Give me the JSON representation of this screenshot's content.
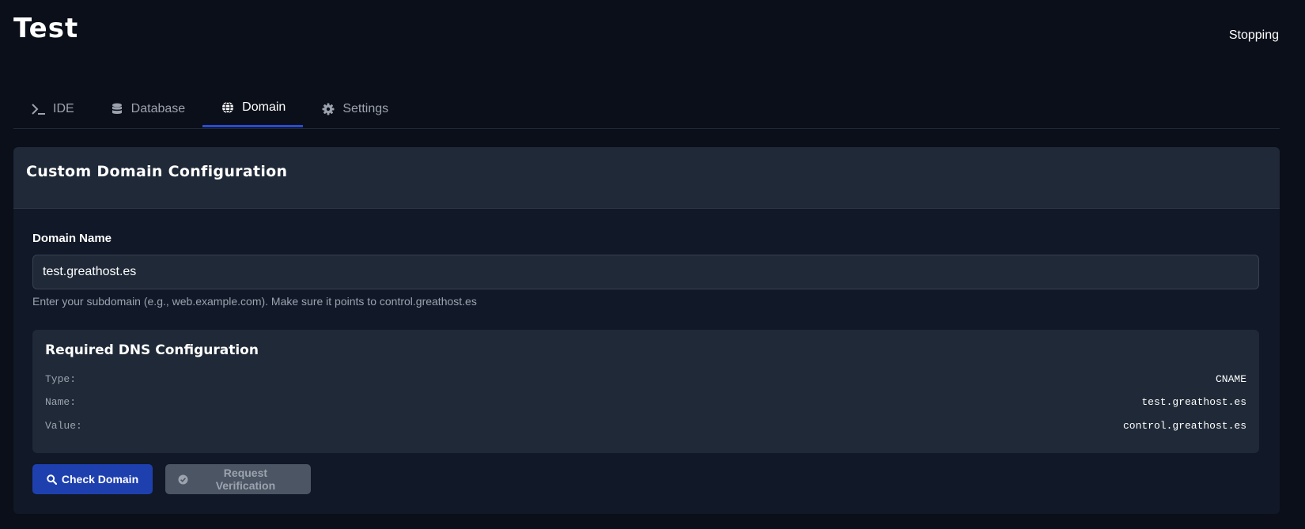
{
  "header": {
    "title": "Test",
    "status": "Stopping"
  },
  "tabs": [
    {
      "label": "IDE",
      "icon": "terminal-icon",
      "active": false
    },
    {
      "label": "Database",
      "icon": "database-icon",
      "active": false
    },
    {
      "label": "Domain",
      "icon": "globe-icon",
      "active": true
    },
    {
      "label": "Settings",
      "icon": "gear-icon",
      "active": false
    }
  ],
  "card": {
    "title": "Custom Domain Configuration",
    "domain_label": "Domain Name",
    "domain_value": "test.greathost.es",
    "help_text": "Enter your subdomain (e.g., web.example.com). Make sure it points to control.greathost.es"
  },
  "dns": {
    "title": "Required DNS Configuration",
    "rows": [
      {
        "key": "Type:",
        "value": "CNAME"
      },
      {
        "key": "Name:",
        "value": "test.greathost.es"
      },
      {
        "key": "Value:",
        "value": "control.greathost.es"
      }
    ]
  },
  "actions": {
    "check_label": "Check Domain",
    "verify_label": "Request Verification",
    "verify_disabled": true
  },
  "colors": {
    "background": "#0b0f19",
    "card": "#111827",
    "panel": "#1f2937",
    "accent": "#2a4bd0",
    "primary_button": "#1e40af",
    "disabled_button": "#4b5563"
  }
}
